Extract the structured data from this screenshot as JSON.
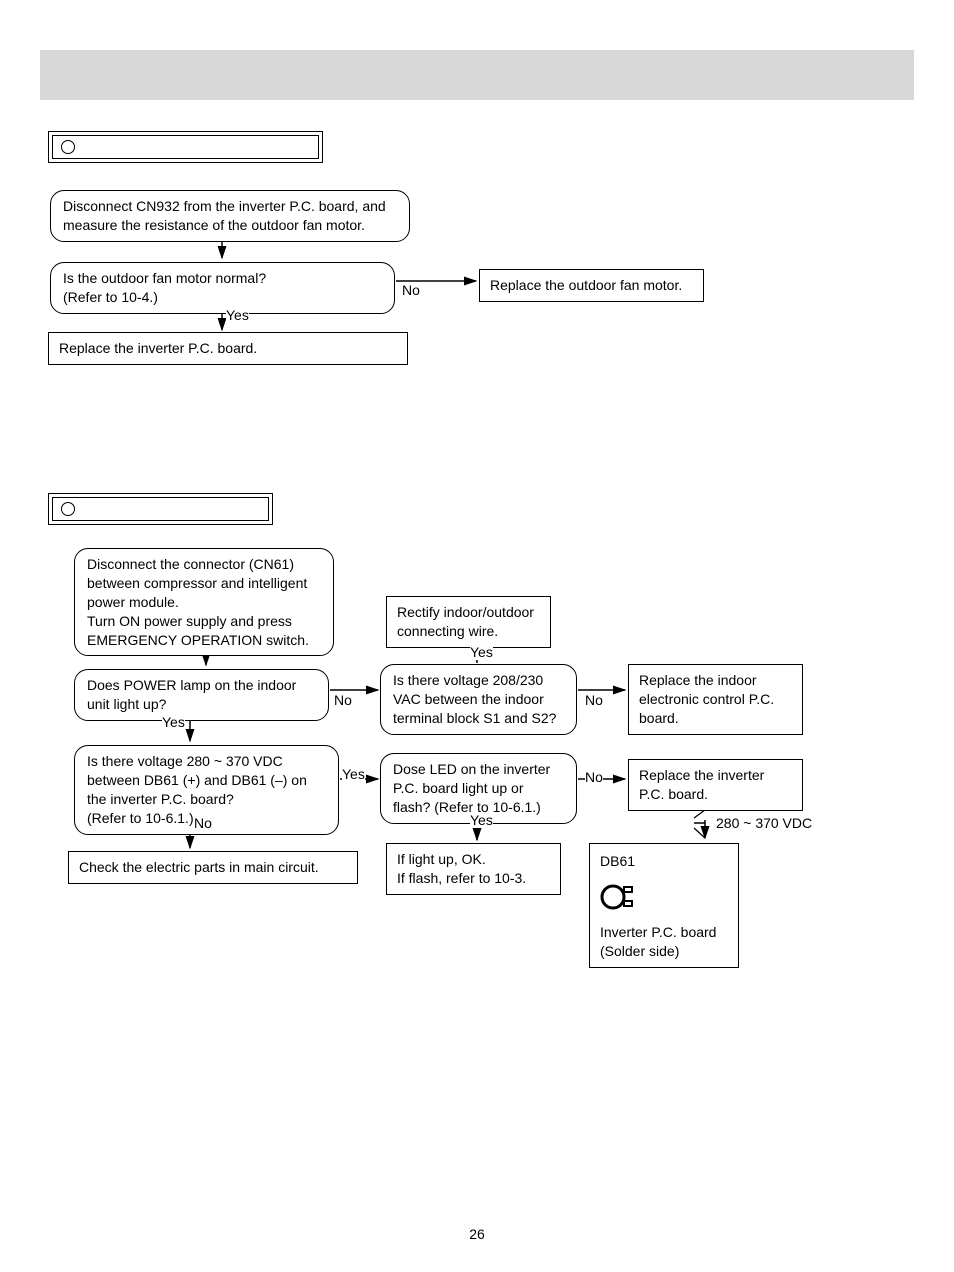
{
  "flow1": {
    "step1": "Disconnect CN932 from the inverter P.C. board, and measure the resistance of the outdoor fan motor.",
    "decision1": "Is the outdoor fan motor normal?\n(Refer to 10-4.)",
    "no": "No",
    "yes": "Yes",
    "action_no": "Replace the outdoor fan motor.",
    "action_yes": "Replace the inverter P.C. board."
  },
  "flow2": {
    "step1": "Disconnect the connector (CN61) between compressor and intelligent power module.\nTurn ON power supply and press EMERGENCY OPERATION switch.",
    "rectify": "Rectify indoor/outdoor connecting wire.",
    "dec_power": "Does POWER lamp on the indoor unit light up?",
    "dec_s1s2": "Is there voltage 208/230 VAC between the indoor terminal block S1 and S2?",
    "act_replace_indoor": "Replace the indoor electronic control P.C. board.",
    "dec_db61": "Is there voltage 280 ~ 370 VDC between DB61 (+) and DB61 (–) on the inverter P.C. board?\n(Refer to 10-6.1.)",
    "dec_led": "Dose LED on the inverter P.C. board light up or flash? (Refer to 10-6.1.)",
    "act_replace_inv": "Replace the inverter P.C. board.",
    "act_check": "Check the electric parts in main circuit.",
    "act_light": "If light up, OK.\nIf flash, refer to 10-3.",
    "yes": "Yes",
    "no": "No",
    "vdc_label": "280 ~ 370 VDC",
    "db61_label": "DB61",
    "board_label1": "Inverter P.C. board",
    "board_label2": "(Solder side)"
  },
  "page": "26"
}
